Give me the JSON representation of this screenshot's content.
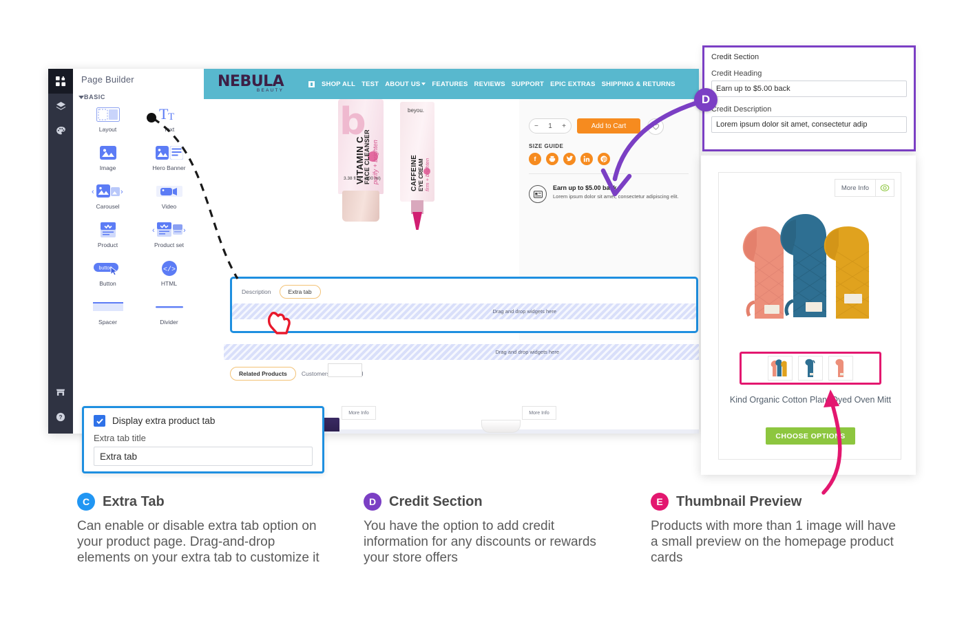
{
  "builder": {
    "panel_title": "Page Builder",
    "section_label": "BASIC",
    "rail_icons": [
      "grid-icon",
      "layers-icon",
      "palette-icon",
      "store-icon",
      "help-icon"
    ],
    "widgets": [
      {
        "label": "Layout",
        "icon": "layout-icon"
      },
      {
        "label": "Text",
        "icon": "text-icon"
      },
      {
        "label": "Image",
        "icon": "image-icon"
      },
      {
        "label": "Hero Banner",
        "icon": "hero-banner-icon"
      },
      {
        "label": "Carousel",
        "icon": "carousel-icon"
      },
      {
        "label": "Video",
        "icon": "video-icon"
      },
      {
        "label": "Product",
        "icon": "product-icon"
      },
      {
        "label": "Product set",
        "icon": "product-set-icon"
      },
      {
        "label": "Button",
        "icon": "button-icon"
      },
      {
        "label": "HTML",
        "icon": "html-icon"
      },
      {
        "label": "Spacer",
        "icon": "spacer-icon"
      },
      {
        "label": "Divider",
        "icon": "divider-icon"
      }
    ]
  },
  "store": {
    "logo_main": "NEBULA",
    "logo_sub": "BEAUTY",
    "nav": [
      "SHOP ALL",
      "TEST",
      "ABOUT US",
      "FEATURES",
      "REVIEWS",
      "SUPPORT",
      "EPIC EXTRAS",
      "SHIPPING & RETURNS"
    ],
    "header_color": "#58b8ce"
  },
  "pdp": {
    "qty_minus": "−",
    "qty_value": "1",
    "qty_plus": "+",
    "add_to_cart": "Add to Cart",
    "size_guide": "SIZE GUIDE",
    "social": [
      "facebook-icon",
      "print-icon",
      "twitter-icon",
      "linkedin-icon",
      "pinterest-icon"
    ],
    "credit_heading": "Earn up to $5.00 back",
    "credit_description": "Lorem ipsum dolor sit amet, consectetur adipiscing elit.",
    "product1_brand": "b",
    "product1_name": "VITAMIN C",
    "product1_sub": "FACE CLEANSER",
    "product1_tag": "purify + brighten",
    "product1_volume": "3.38 fl oz. (100 ml)",
    "product2_brand": "beyou.",
    "product2_name": "CAFFEINE",
    "product2_sub": "EYE CREAM",
    "product2_tag": "firm + brighten"
  },
  "tabs": {
    "description_tab": "Description",
    "extra_tab": "Extra tab",
    "dropzone_label": "Drag and drop widgets here",
    "related_active": "Related Products",
    "related_inactive": "Customers Also Viewed",
    "more_info": "More Info"
  },
  "credit_panel": {
    "title": "Credit Section",
    "heading_label": "Credit Heading",
    "heading_value": "Earn up to $5.00 back",
    "description_label": "Credit Description",
    "description_value": "Lorem ipsum dolor sit amet, consectetur adip",
    "border_color": "#7b3fc4"
  },
  "extra_panel": {
    "checkbox_label": "Display extra product tab",
    "checked": true,
    "title_label": "Extra tab title",
    "title_value": "Extra tab",
    "border_color": "#1e8fe0"
  },
  "preview_card": {
    "more_info": "More Info",
    "eye_icon": "eye-icon",
    "product_title": "Kind Organic Cotton Plant Dyed Oven Mitt",
    "cta": "CHOOSE OPTIONS",
    "cta_color": "#8dc63f",
    "thumb_highlight_color": "#e3176f",
    "thumbnails": [
      "all-three-mitts",
      "blue-mitt",
      "coral-mitt"
    ],
    "mitt_colors": [
      "#ec8f7a",
      "#2e6f92",
      "#e0a21e"
    ]
  },
  "captions": [
    {
      "letter": "C",
      "color": "#2196f3",
      "title": "Extra Tab",
      "body": "Can enable or disable extra tab option on your product page. Drag-and-drop elements on your extra tab to customize it"
    },
    {
      "letter": "D",
      "color": "#7b3fc4",
      "title": "Credit Section",
      "body": "You have the option to add credit information for any discounts or rewards your store offers"
    },
    {
      "letter": "E",
      "color": "#e3176f",
      "title": "Thumbnail Preview",
      "body": "Products with more than 1 image will have a small preview on the homepage product cards"
    }
  ]
}
